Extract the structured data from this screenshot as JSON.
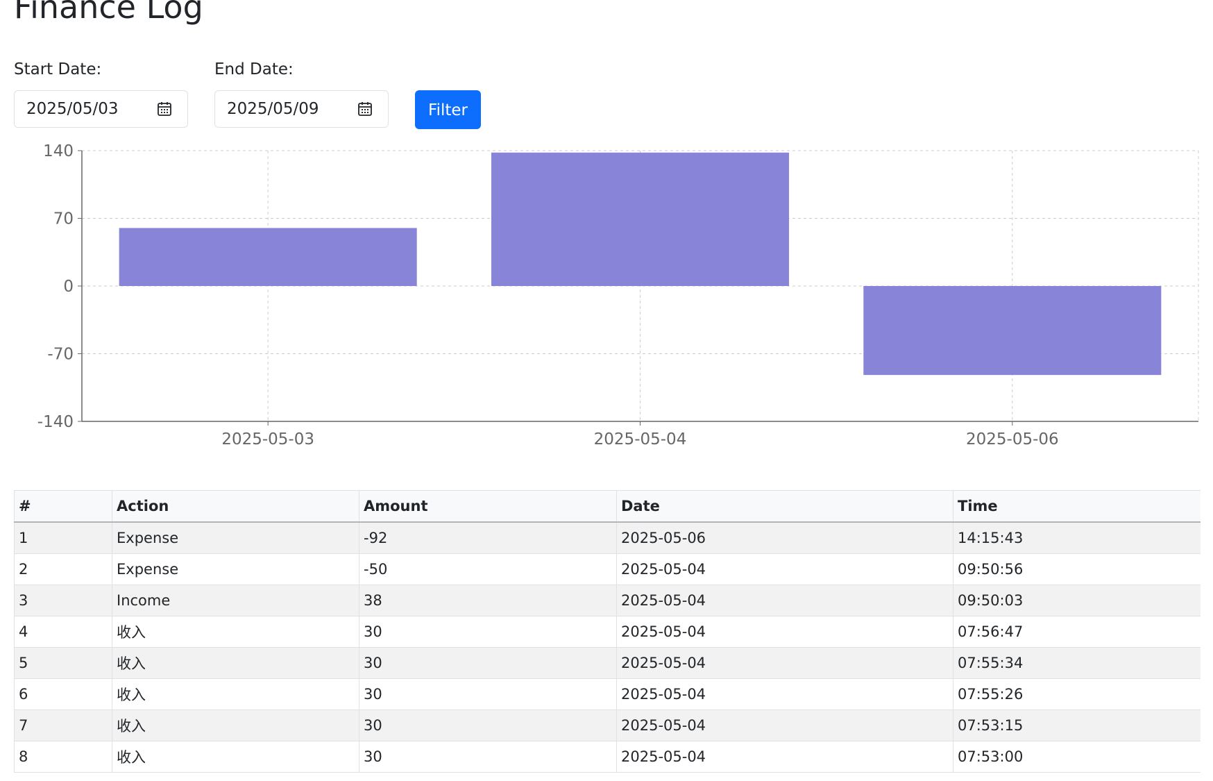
{
  "page": {
    "title": "Finance Log"
  },
  "filters": {
    "start_label": "Start Date:",
    "start_value": "2025/05/03",
    "end_label": "End Date:",
    "end_value": "2025/05/09",
    "button_label": "Filter"
  },
  "colors": {
    "bar": "#8884d8",
    "primary_button": "#0d6efd",
    "grid": "#cccccc",
    "axis": "#666666"
  },
  "chart_data": {
    "type": "bar",
    "categories": [
      "2025-05-03",
      "2025-05-04",
      "2025-05-06"
    ],
    "values": [
      60,
      138,
      -92
    ],
    "yticks": [
      140,
      70,
      0,
      -70,
      -140
    ],
    "ylim": [
      -140,
      140
    ],
    "grid": true,
    "legend": false
  },
  "table": {
    "columns": [
      "#",
      "Action",
      "Amount",
      "Date",
      "Time"
    ],
    "rows": [
      [
        "1",
        "Expense",
        "-92",
        "2025-05-06",
        "14:15:43"
      ],
      [
        "2",
        "Expense",
        "-50",
        "2025-05-04",
        "09:50:56"
      ],
      [
        "3",
        "Income",
        "38",
        "2025-05-04",
        "09:50:03"
      ],
      [
        "4",
        "收入",
        "30",
        "2025-05-04",
        "07:56:47"
      ],
      [
        "5",
        "收入",
        "30",
        "2025-05-04",
        "07:55:34"
      ],
      [
        "6",
        "收入",
        "30",
        "2025-05-04",
        "07:55:26"
      ],
      [
        "7",
        "收入",
        "30",
        "2025-05-04",
        "07:53:15"
      ],
      [
        "8",
        "收入",
        "30",
        "2025-05-04",
        "07:53:00"
      ]
    ]
  }
}
